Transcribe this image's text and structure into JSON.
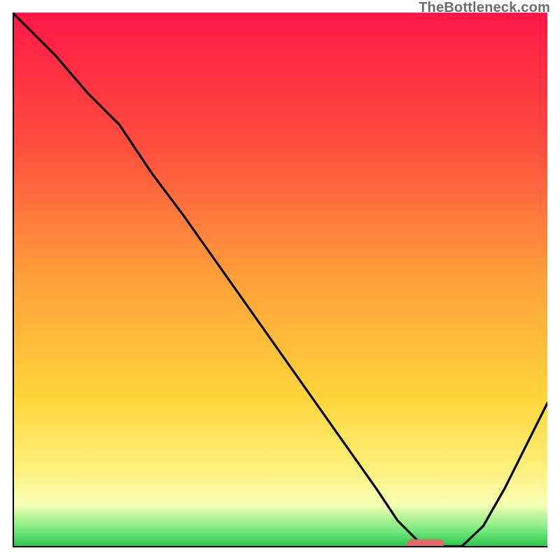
{
  "watermark": "TheBottleneck.com",
  "colors": {
    "top": "#ff1846",
    "upper": "#ff4e3e",
    "mid": "#ffa13a",
    "yellow": "#ffd53a",
    "lightyellow": "#fff07a",
    "paleyellow": "#f6ffb4",
    "green": "#6fe87a",
    "greenDeep": "#27c24c",
    "axis": "#000000",
    "curve": "#000000",
    "pill": "#e26a6a"
  },
  "chart_data": {
    "type": "line",
    "title": "",
    "xlabel": "",
    "ylabel": "",
    "xlim": [
      0,
      100
    ],
    "ylim": [
      0,
      100
    ],
    "grid": false,
    "x": [
      0,
      8,
      14,
      20,
      26,
      32,
      38,
      44,
      50,
      56,
      62,
      68,
      72,
      76,
      80,
      84,
      88,
      92,
      96,
      100
    ],
    "values": [
      100,
      92,
      85,
      79,
      70,
      62,
      53.5,
      45,
      36.5,
      28,
      19.5,
      11,
      5,
      1,
      0.2,
      0.2,
      4,
      11,
      19,
      27
    ],
    "series": [
      {
        "name": "bottleneck-curve",
        "x_ref": "x",
        "y_ref": "values"
      }
    ],
    "marker": {
      "name": "sweet-spot-pill",
      "x_center": 77.2,
      "x_halfwidth": 3.5,
      "y": 0.6
    },
    "annotations": []
  }
}
